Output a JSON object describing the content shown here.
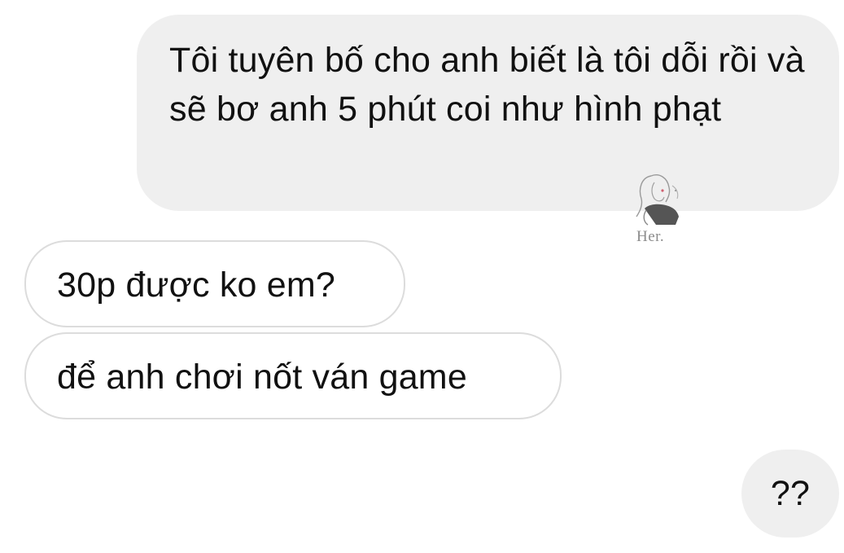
{
  "conversation": {
    "messages": [
      {
        "direction": "outgoing",
        "text": "Tôi tuyên bố cho anh biết là tôi dỗi rồi và sẽ bơ anh 5 phút coi như hình phạt"
      },
      {
        "direction": "incoming",
        "text": "30p được ko em?"
      },
      {
        "direction": "incoming",
        "text": "để anh chơi nốt ván game"
      },
      {
        "direction": "outgoing",
        "text": "??"
      }
    ]
  },
  "watermark": {
    "text": "Her.",
    "icon": "woman-portrait-logo"
  },
  "colors": {
    "outgoing_bubble": "#efefef",
    "incoming_bubble": "#ffffff",
    "incoming_border": "#dcdcdc",
    "text": "#111111"
  }
}
